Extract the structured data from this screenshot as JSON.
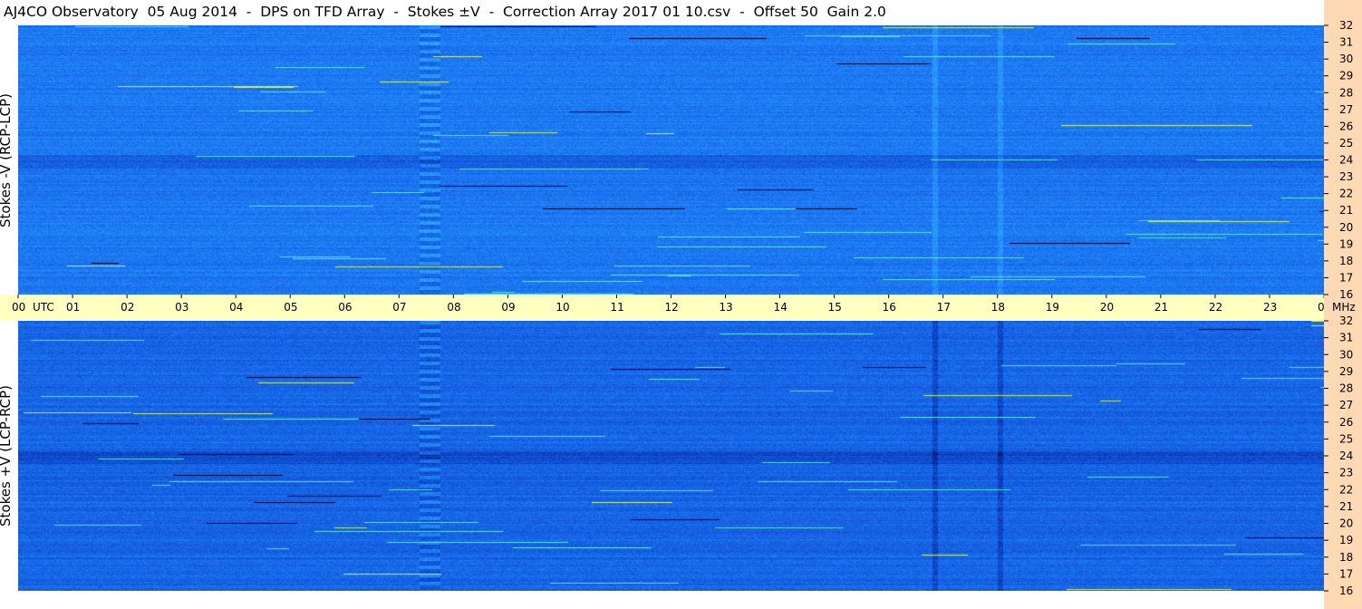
{
  "title": "AJ4CO Observatory  05 Aug 2014  -  DPS on TFD Array  -  Stokes ±V  -  Correction Array 2017 01 10.csv  -  Offset 50  Gain 2.0",
  "chart_data": [
    {
      "type": "heatmap",
      "panel": "top",
      "ylabel": "Stokes -V (RCP-LCP)",
      "x_ticks": [
        "00",
        "01",
        "02",
        "03",
        "04",
        "05",
        "06",
        "07",
        "08",
        "09",
        "10",
        "11",
        "12",
        "13",
        "14",
        "15",
        "16",
        "17",
        "18",
        "19",
        "20",
        "21",
        "22",
        "23",
        "00"
      ],
      "x_unit": "UTC",
      "xlim": [
        0,
        24
      ],
      "y_ticks": [
        "16",
        "17",
        "18",
        "19",
        "20",
        "21",
        "22",
        "23",
        "24",
        "25",
        "26",
        "27",
        "28",
        "29",
        "30",
        "31",
        "32"
      ],
      "y_unit": "MHz",
      "ylim": [
        16,
        32
      ],
      "colormap_colors": [
        "#000033",
        "#0b3fbf",
        "#1a6ff0",
        "#2ba6ff",
        "#58e0e0",
        "#c8f060",
        "#ff4020"
      ]
    },
    {
      "type": "heatmap",
      "panel": "bottom",
      "ylabel": "Stokes +V (LCP-RCP)",
      "x_ticks": [
        "00",
        "01",
        "02",
        "03",
        "04",
        "05",
        "06",
        "07",
        "08",
        "09",
        "10",
        "11",
        "12",
        "13",
        "14",
        "15",
        "16",
        "17",
        "18",
        "19",
        "20",
        "21",
        "22",
        "23",
        "00"
      ],
      "x_unit": "UTC",
      "xlim": [
        0,
        24
      ],
      "y_ticks": [
        "16",
        "17",
        "18",
        "19",
        "20",
        "21",
        "22",
        "23",
        "24",
        "25",
        "26",
        "27",
        "28",
        "29",
        "30",
        "31",
        "32"
      ],
      "y_unit": "MHz",
      "ylim": [
        16,
        32
      ],
      "colormap_colors": [
        "#000033",
        "#0b3fbf",
        "#1a6ff0",
        "#2ba6ff",
        "#58e0e0",
        "#c8f060",
        "#ff4020"
      ]
    }
  ],
  "time_axis": {
    "unit_label": "UTC",
    "freq_unit_label": "MHz"
  },
  "colors": {
    "time_axis_bg": "#ffffc0",
    "freq_axis_bg": "#ffd9b3",
    "title_bg": "#ffffff"
  }
}
